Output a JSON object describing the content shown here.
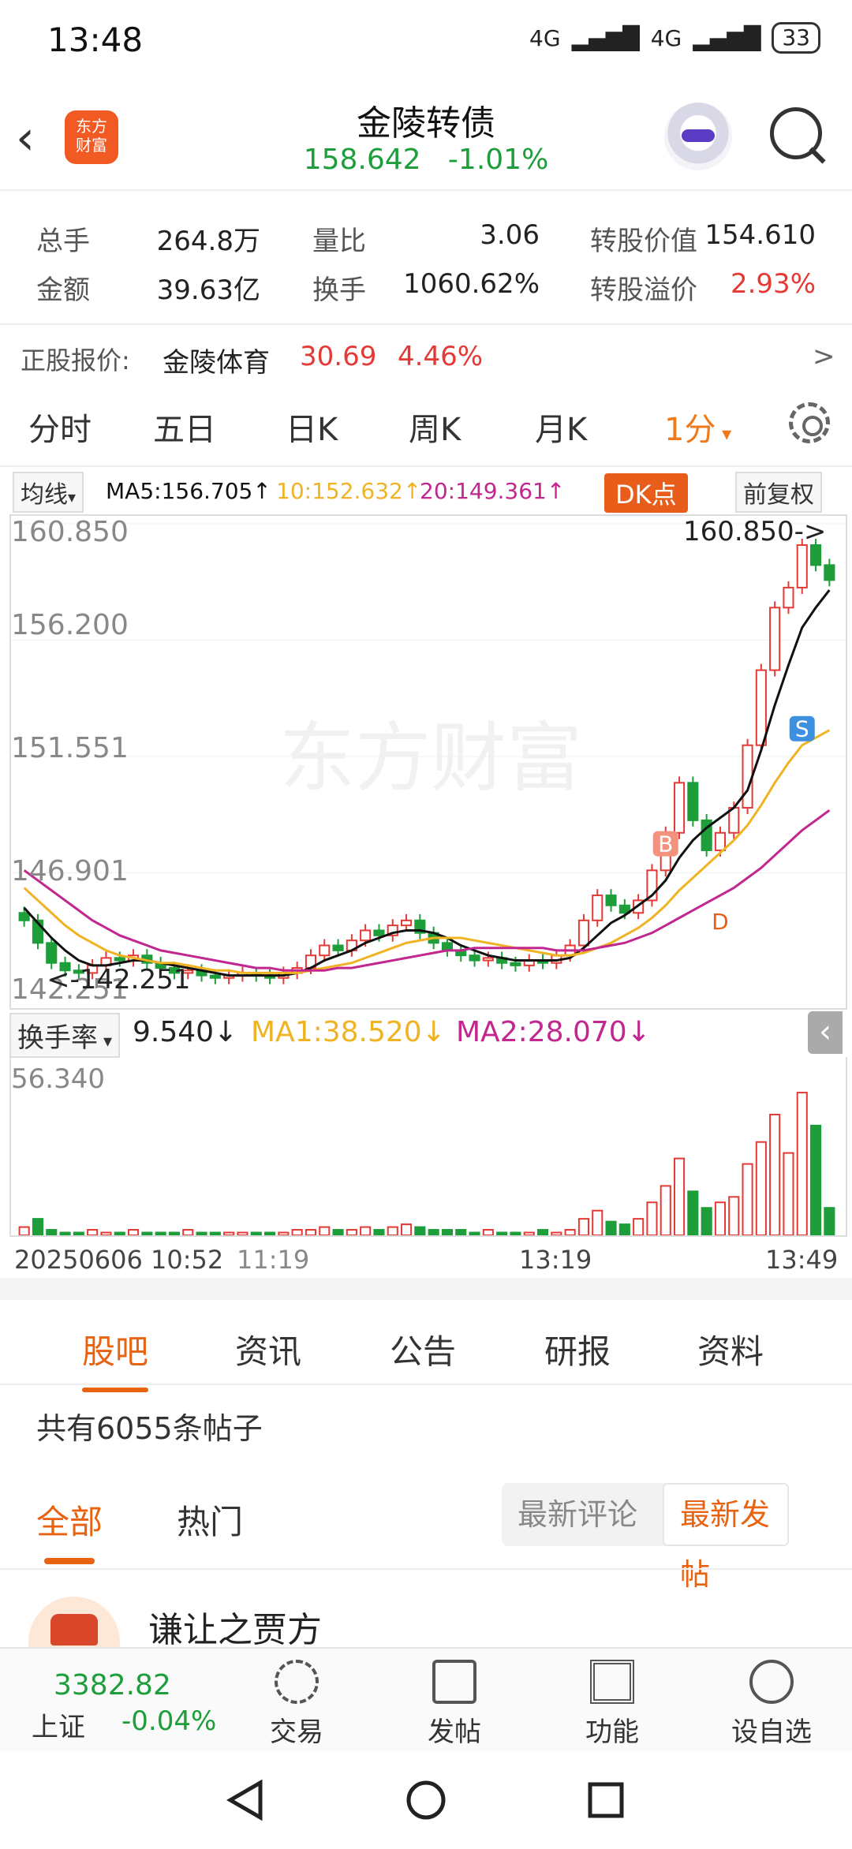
{
  "status": {
    "time": "13:48",
    "network1": "4G",
    "network2": "4G",
    "battery": "33"
  },
  "header": {
    "back_icon": "back-arrow-icon",
    "logo_top": "东方",
    "logo_bottom": "财富",
    "title": "金陵转债",
    "price": "158.642",
    "change": "-1.01%"
  },
  "info": {
    "rows": [
      {
        "l1": "总手",
        "v1": "264.8万",
        "l2": "量比",
        "v2": "3.06",
        "l3": "转股价值",
        "v3": "154.610"
      },
      {
        "l1": "金额",
        "v1": "39.63亿",
        "l2": "换手",
        "v2": "1060.62%",
        "l3": "转股溢价",
        "v3": "2.93%"
      }
    ],
    "stock_label": "正股报价:",
    "stock_name": "金陵体育",
    "stock_price": "30.69",
    "stock_change": "4.46%",
    "more": ">"
  },
  "ktabs": [
    "分时",
    "五日",
    "日K",
    "周K",
    "月K"
  ],
  "ktab_active": "1分",
  "ma": {
    "selector": "均线",
    "ma5": "MA5:156.705↑",
    "ma10": "10:152.632↑",
    "ma20": "20:149.361↑",
    "dk": "DK点",
    "fuquan": "前复权"
  },
  "chart_data": {
    "type": "candlestick",
    "y_ticks": [
      "160.850",
      "156.200",
      "151.551",
      "146.901",
      "142.251"
    ],
    "ylim": [
      142.251,
      160.85
    ],
    "max_label": "160.850->",
    "min_label": "<-142.251",
    "markers": [
      "B",
      "S",
      "D"
    ],
    "watermark": "东方财富",
    "closes": [
      145.0,
      144.1,
      143.3,
      143.0,
      142.9,
      143.2,
      143.5,
      143.4,
      143.6,
      143.3,
      143.1,
      142.9,
      143.0,
      142.8,
      142.7,
      142.8,
      142.9,
      142.8,
      142.7,
      142.9,
      143.1,
      143.6,
      144.0,
      143.8,
      144.2,
      144.6,
      144.4,
      144.8,
      145.0,
      144.5,
      144.1,
      143.8,
      143.6,
      143.4,
      143.5,
      143.3,
      143.2,
      143.4,
      143.3,
      143.6,
      144.0,
      145.0,
      146.0,
      145.6,
      145.3,
      145.8,
      147.0,
      148.5,
      150.5,
      149.0,
      147.8,
      148.5,
      149.5,
      152.0,
      155.0,
      157.5,
      158.3,
      160.0,
      159.2,
      158.6
    ],
    "ma5": [
      145.5,
      144.9,
      144.3,
      143.8,
      143.4,
      143.2,
      143.2,
      143.3,
      143.4,
      143.4,
      143.3,
      143.2,
      143.1,
      143.0,
      142.9,
      142.8,
      142.8,
      142.8,
      142.8,
      142.8,
      142.9,
      143.1,
      143.4,
      143.6,
      143.8,
      144.1,
      144.3,
      144.5,
      144.6,
      144.6,
      144.5,
      144.3,
      144.0,
      143.8,
      143.6,
      143.5,
      143.4,
      143.4,
      143.4,
      143.4,
      143.5,
      143.9,
      144.4,
      144.9,
      145.2,
      145.6,
      146.0,
      146.6,
      147.5,
      148.2,
      148.7,
      149.1,
      149.5,
      150.2,
      151.8,
      153.6,
      155.2,
      156.7,
      157.5,
      158.2
    ],
    "ma10": [
      146.3,
      145.8,
      145.3,
      144.8,
      144.4,
      144.1,
      143.8,
      143.6,
      143.5,
      143.4,
      143.3,
      143.3,
      143.2,
      143.1,
      143.0,
      143.0,
      142.9,
      142.9,
      142.9,
      142.9,
      142.9,
      143.0,
      143.1,
      143.2,
      143.3,
      143.5,
      143.7,
      143.9,
      144.1,
      144.2,
      144.3,
      144.3,
      144.3,
      144.2,
      144.1,
      144.0,
      143.9,
      143.8,
      143.7,
      143.6,
      143.6,
      143.7,
      143.9,
      144.1,
      144.4,
      144.7,
      145.1,
      145.6,
      146.2,
      146.7,
      147.2,
      147.7,
      148.2,
      148.8,
      149.6,
      150.5,
      151.3,
      152.0,
      152.3,
      152.6
    ],
    "ma20": [
      147.0,
      146.6,
      146.2,
      145.8,
      145.4,
      145.0,
      144.7,
      144.4,
      144.2,
      144.0,
      143.8,
      143.7,
      143.6,
      143.5,
      143.4,
      143.3,
      143.2,
      143.1,
      143.1,
      143.0,
      143.0,
      143.0,
      143.0,
      143.1,
      143.1,
      143.2,
      143.3,
      143.4,
      143.5,
      143.6,
      143.7,
      143.8,
      143.8,
      143.9,
      143.9,
      143.9,
      143.9,
      143.9,
      143.9,
      143.8,
      143.8,
      143.8,
      143.9,
      144.0,
      144.1,
      144.3,
      144.5,
      144.8,
      145.1,
      145.4,
      145.7,
      146.0,
      146.3,
      146.7,
      147.1,
      147.6,
      148.1,
      148.6,
      149.0,
      149.4
    ],
    "turnover": {
      "label": "换手率",
      "value": "9.540↓",
      "ma1": "MA1:38.520↓",
      "ma2": "MA2:28.070↓",
      "ymax_label": "56.340",
      "values": [
        3,
        6,
        2,
        1,
        1,
        2,
        1,
        1,
        2,
        1,
        1,
        1,
        2,
        1,
        1,
        1,
        1,
        1,
        1,
        1,
        2,
        2,
        3,
        2,
        2,
        3,
        2,
        3,
        4,
        3,
        2,
        2,
        2,
        1,
        2,
        1,
        1,
        1,
        2,
        1,
        2,
        6,
        9,
        5,
        4,
        6,
        12,
        18,
        28,
        16,
        10,
        12,
        14,
        26,
        34,
        44,
        30,
        52,
        40,
        10
      ]
    },
    "time_labels": [
      "20250606 10:52",
      "11:19",
      "13:19",
      "13:49"
    ]
  },
  "community": {
    "tabs": [
      "股吧",
      "资讯",
      "公告",
      "研报",
      "资料"
    ],
    "posts_count": "共有6055条帖子",
    "filters": [
      "全部",
      "热门"
    ],
    "sorts": [
      "最新评论",
      "最新发帖"
    ],
    "user": "谦让之贾方"
  },
  "bottom": {
    "index_value": "3382.82",
    "index_name": "上证",
    "index_change": "-0.04%",
    "items": [
      "交易",
      "发帖",
      "功能",
      "设自选"
    ]
  },
  "colors": {
    "up": "#e53935",
    "down": "#1e9e3a",
    "accent": "#e8620f",
    "ma5": "#111111",
    "ma10": "#f0b323",
    "ma20": "#c2268f"
  }
}
